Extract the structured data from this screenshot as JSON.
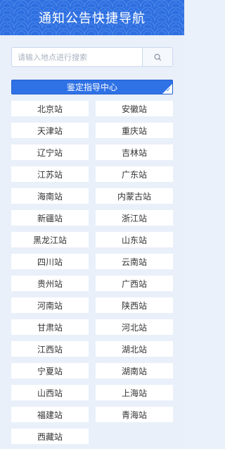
{
  "header": {
    "title": "通知公告快捷导航"
  },
  "search": {
    "placeholder": "请输入地点进行搜索",
    "icon": "search-icon"
  },
  "featured": {
    "label": "鉴定指导中心",
    "icon": "check-icon"
  },
  "stations": [
    "北京站",
    "安徽站",
    "天津站",
    "重庆站",
    "辽宁站",
    "吉林站",
    "江苏站",
    "广东站",
    "海南站",
    "内蒙古站",
    "新疆站",
    "浙江站",
    "黑龙江站",
    "山东站",
    "四川站",
    "云南站",
    "贵州站",
    "广西站",
    "河南站",
    "陕西站",
    "甘肃站",
    "河北站",
    "江西站",
    "湖北站",
    "宁夏站",
    "湖南站",
    "山西站",
    "上海站",
    "福建站",
    "青海站",
    "西藏站"
  ],
  "colors": {
    "accent": "#2f72e6",
    "header_bg": "#2e6fe0",
    "page_bg": "#e9f0fa"
  }
}
